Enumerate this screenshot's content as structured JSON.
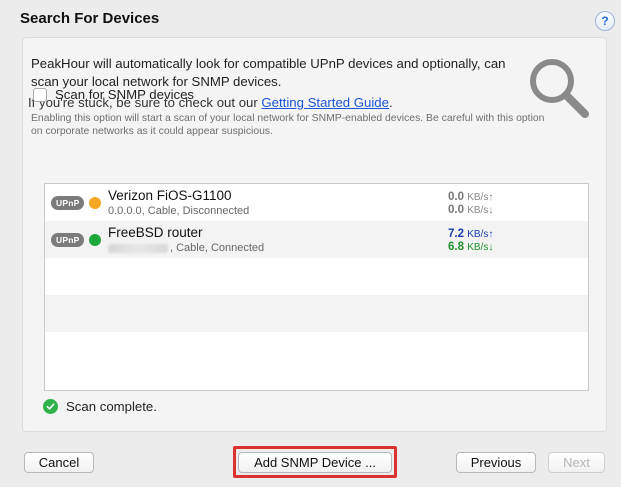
{
  "window": {
    "title": "Search For Devices",
    "help_label": "?"
  },
  "intro": {
    "text": "PeakHour will automatically look for compatible UPnP devices and optionally, can scan your local network for SNMP devices.",
    "stuck_prefix": "If you're stuck, be sure to check out our ",
    "guide_link": "Getting Started Guide",
    "stuck_suffix": "."
  },
  "snmp": {
    "checkbox_label": "Scan for SNMP devices",
    "checked": false,
    "note": "Enabling this option will start a scan of your local network for SNMP-enabled devices. Be careful with this option on corporate networks as it could appear suspicious."
  },
  "devices": [
    {
      "badge": "UPnP",
      "status_color": "#f5a623",
      "name": "Verizon FiOS-G1100",
      "detail": "0.0.0.0, Cable, Disconnected",
      "up_value": "0.0",
      "up_unit": "KB/s↑",
      "down_value": "0.0",
      "down_unit": "KB/s↓",
      "up_color": "#777777",
      "down_color": "#777777"
    },
    {
      "badge": "UPnP",
      "status_color": "#1fa83a",
      "name": "FreeBSD router",
      "detail": ", Cable, Connected",
      "up_value": "7.2",
      "up_unit": "KB/s↑",
      "down_value": "6.8",
      "down_unit": "KB/s↓",
      "up_color": "#1a3fb0",
      "down_color": "#1f8f2e"
    }
  ],
  "status": {
    "text": "Scan complete."
  },
  "buttons": {
    "cancel": "Cancel",
    "add_snmp": "Add SNMP Device ...",
    "previous": "Previous",
    "next": "Next"
  },
  "colors": {
    "highlight": "#d9322f",
    "link": "#1a55d6"
  }
}
